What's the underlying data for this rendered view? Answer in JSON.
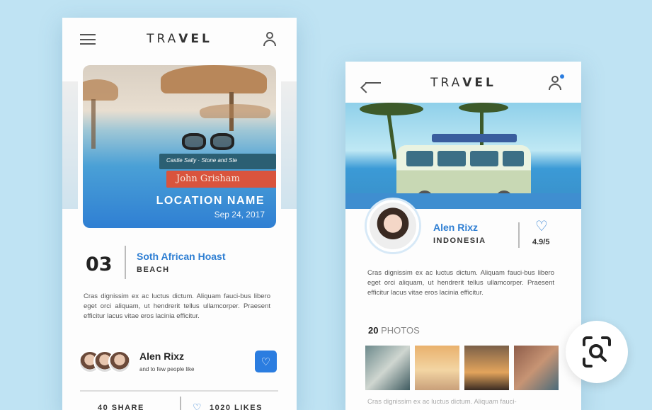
{
  "left_screen": {
    "brand": {
      "light": "TRA",
      "bold": "VEL"
    },
    "hero": {
      "location_name": "LOCATION NAME",
      "date": "Sep 24, 2017",
      "book_text_1": "John Grisham",
      "book_text_2": "Castle Sally · Stone and Ste"
    },
    "entry": {
      "number": "03",
      "title": "Soth African Hoast",
      "category": "BEACH"
    },
    "description": "Cras dignissim ex ac luctus dictum. Aliquam fauci-bus libero eget orci aliquam, ut hendrerit tellus ullamcorper. Praesent efficitur lacus vitae eros lacinia efficitur.",
    "author": {
      "name": "Alen Rixz",
      "subtitle": "and to few people like"
    },
    "footer": {
      "share": "40 SHARE",
      "likes": "1020 LIKES"
    }
  },
  "right_screen": {
    "brand": {
      "light": "TRA",
      "bold": "VEL"
    },
    "profile": {
      "name": "Alen Rixz",
      "country": "INDONESIA",
      "rating": "4.9/5"
    },
    "description": "Cras dignissim ex ac luctus dictum. Aliquam fauci-bus libero eget orci aliquam, ut hendrerit tellus ullamcorper. Praesent efficitur lacus vitae eros lacinia efficitur.",
    "photos": {
      "count": "20",
      "label": "PHOTOS"
    },
    "bottom_text": "Cras dignissim ex ac luctus dictum. Aliquam fauci-"
  },
  "colors": {
    "accent": "#2f7fd3",
    "background": "#bfe3f3"
  },
  "icons": [
    "menu-icon",
    "user-icon",
    "back-arrow-icon",
    "user-notification-icon",
    "heart-icon",
    "zoom-search-icon"
  ]
}
